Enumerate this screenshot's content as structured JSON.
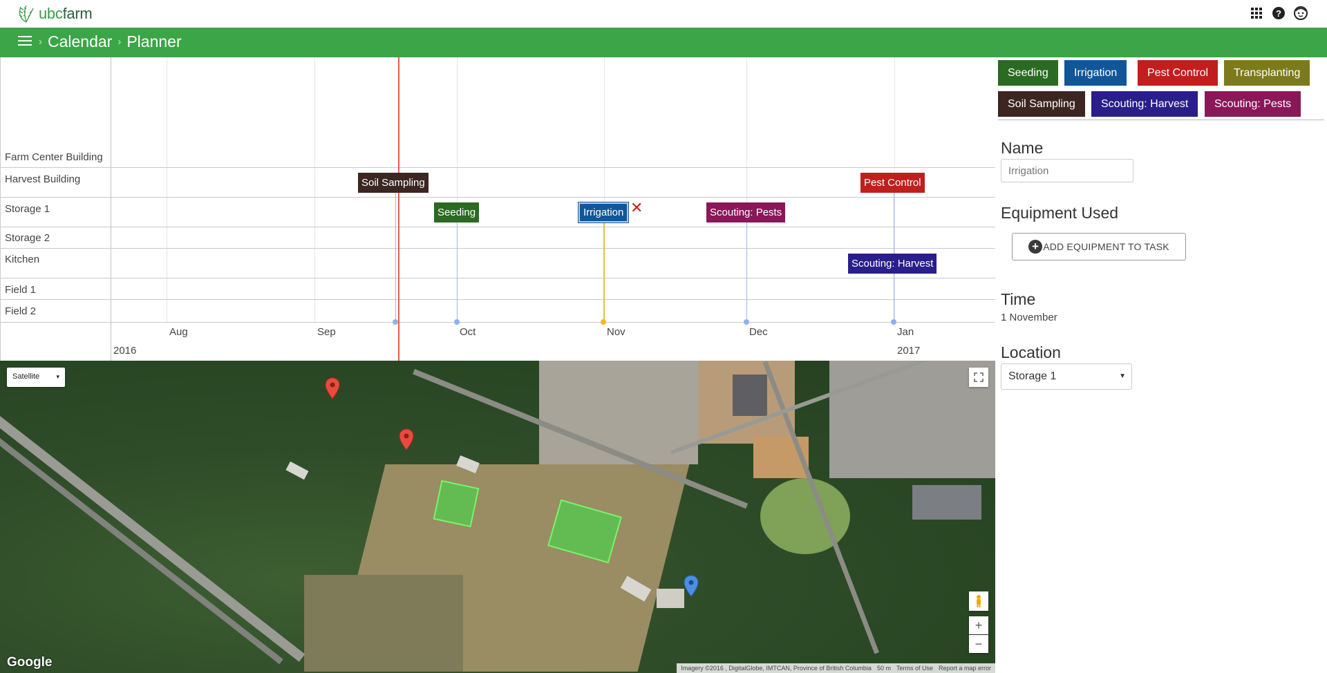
{
  "brand": {
    "name_prefix": "ubc",
    "name_suffix": "farm"
  },
  "header": {
    "breadcrumbs": [
      "Calendar",
      "Planner"
    ]
  },
  "planner": {
    "rows": [
      "Farm Center Building",
      "Harvest Building",
      "Storage 1",
      "Storage 2",
      "Kitchen",
      "Field 1",
      "Field 2"
    ],
    "months": [
      "Aug",
      "Sep",
      "Oct",
      "Nov",
      "Dec",
      "Jan"
    ],
    "years": [
      "2016",
      "2017"
    ],
    "tasks": [
      {
        "label": "Soil Sampling",
        "row": "Harvest Building",
        "color": "#3b2622"
      },
      {
        "label": "Pest Control",
        "row": "Harvest Building",
        "color": "#c11e1e"
      },
      {
        "label": "Seeding",
        "row": "Storage 1",
        "color": "#2a6a23"
      },
      {
        "label": "Irrigation",
        "row": "Storage 1",
        "color": "#12569a",
        "selected": true
      },
      {
        "label": "Scouting: Pests",
        "row": "Storage 1",
        "color": "#8a1758"
      },
      {
        "label": "Scouting: Harvest",
        "row": "Kitchen",
        "color": "#2a1e8a"
      }
    ],
    "delete_symbol": "✕"
  },
  "legend": [
    {
      "label": "Seeding",
      "color": "#2a6a23"
    },
    {
      "label": "Irrigation",
      "color": "#12569a"
    },
    {
      "label": "Pest Control",
      "color": "#c11e1e"
    },
    {
      "label": "Transplanting",
      "color": "#7d7a1c"
    },
    {
      "label": "Soil Sampling",
      "color": "#3b2622"
    },
    {
      "label": "Scouting: Harvest",
      "color": "#2a1e8a"
    },
    {
      "label": "Scouting: Pests",
      "color": "#8a1758"
    }
  ],
  "form": {
    "name_label": "Name",
    "name_placeholder": "Irrigation",
    "equipment_label": "Equipment Used",
    "add_equipment_button": "ADD EQUIPMENT TO TASK",
    "time_label": "Time",
    "time_value": "1 November",
    "location_label": "Location",
    "location_value": "Storage 1"
  },
  "map": {
    "type_select": "Satellite",
    "logo": "Google",
    "attribution": "Imagery ©2016 , DigitalGlobe, IMTCAN, Province of British Columbia",
    "scale": "50 m",
    "terms": "Terms of Use",
    "report": "Report a map error",
    "zoom_in": "+",
    "zoom_out": "−"
  }
}
